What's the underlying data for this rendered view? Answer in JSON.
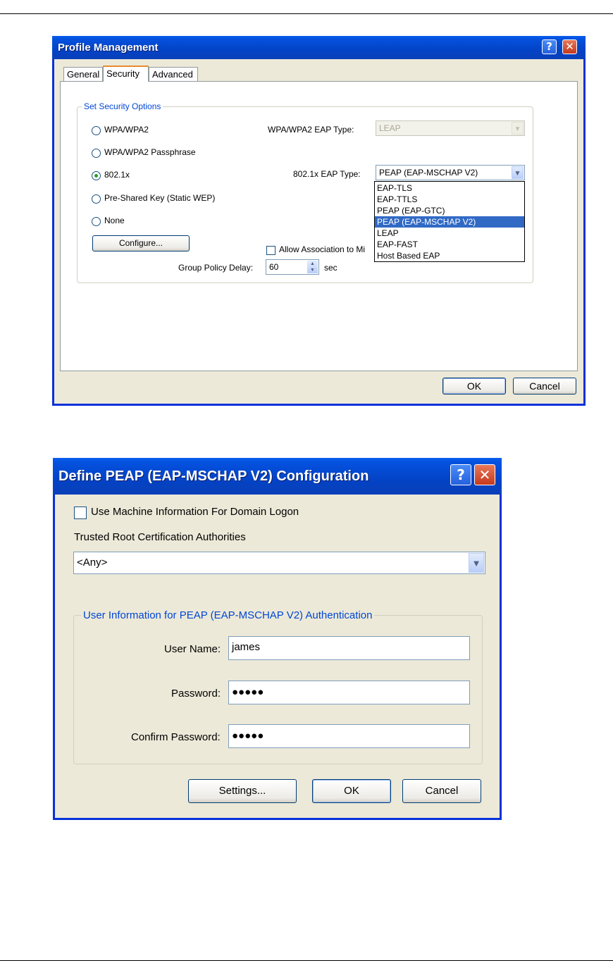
{
  "window1": {
    "title": "Profile Management",
    "help_glyph": "?",
    "close_glyph": "✕",
    "tabs": [
      {
        "label": "General"
      },
      {
        "label": "Security"
      },
      {
        "label": "Advanced"
      }
    ],
    "active_tab": "Security",
    "group_title": "Set Security Options",
    "options": [
      {
        "label": "WPA/WPA2",
        "selected": false
      },
      {
        "label": "WPA/WPA2 Passphrase",
        "selected": false
      },
      {
        "label": "802.1x",
        "selected": true
      },
      {
        "label": "Pre-Shared Key (Static WEP)",
        "selected": false
      },
      {
        "label": "None",
        "selected": false
      }
    ],
    "configure_label": "Configure...",
    "wpa_eap_label": "WPA/WPA2 EAP Type:",
    "wpa_eap_value": "LEAP",
    "eap_8021x_label": "802.1x EAP Type:",
    "eap_8021x_value": "PEAP (EAP-MSCHAP V2)",
    "eap_dropdown_options": [
      "EAP-TLS",
      "EAP-TTLS",
      "PEAP (EAP-GTC)",
      "PEAP (EAP-MSCHAP V2)",
      "LEAP",
      "EAP-FAST",
      "Host Based EAP"
    ],
    "eap_dropdown_selected": "PEAP (EAP-MSCHAP V2)",
    "allow_assoc_label": "Allow Association to Mi",
    "allow_assoc_checked": false,
    "group_policy_label": "Group Policy Delay:",
    "group_policy_value": "60",
    "group_policy_unit": "sec",
    "ok_label": "OK",
    "cancel_label": "Cancel"
  },
  "window2": {
    "title": "Define PEAP (EAP-MSCHAP V2) Configuration",
    "help_glyph": "?",
    "close_glyph": "✕",
    "machine_info_label": "Use Machine Information For Domain Logon",
    "machine_info_checked": false,
    "trusted_root_label": "Trusted Root Certification Authorities",
    "trusted_root_value": "<Any>",
    "group_title": "User Information for PEAP (EAP-MSCHAP V2) Authentication",
    "username_label": "User Name:",
    "username_value": "james",
    "password_label": "Password:",
    "password_value": "●●●●●",
    "confirm_label": "Confirm Password:",
    "confirm_value": "●●●●●",
    "settings_label": "Settings...",
    "ok_label": "OK",
    "cancel_label": "Cancel"
  },
  "icons": {
    "combo_arrow": "chevron-down-icon",
    "spin": "spinner-icon"
  },
  "colors": {
    "title_bar": "#0343c6",
    "dialog_face": "#ece9d8",
    "group_label": "#0046d5",
    "selection": "#316ac5"
  }
}
